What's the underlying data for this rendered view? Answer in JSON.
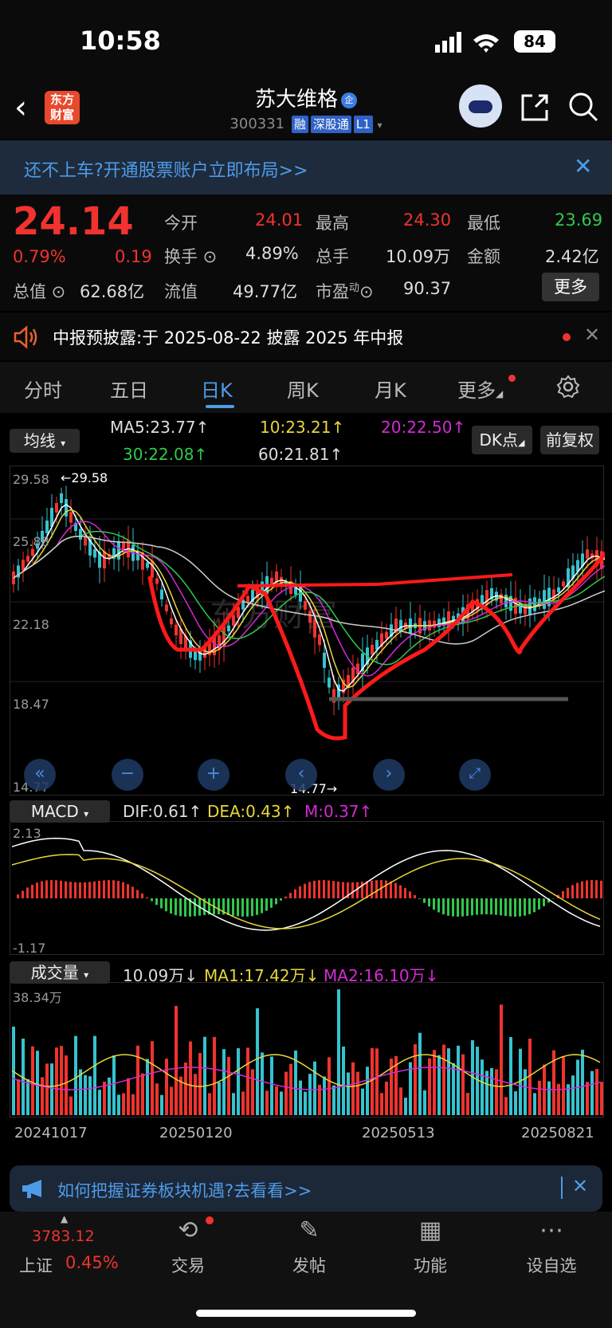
{
  "status": {
    "time": "10:58",
    "battery": "84"
  },
  "header": {
    "back_icon": "chevron-left-icon",
    "logo_line1": "东方",
    "logo_line2": "财富",
    "title": "苏大维格",
    "title_badge": "企",
    "code": "300331",
    "tags": [
      "融",
      "深股通",
      "L1"
    ]
  },
  "banner": {
    "text": "还不上车?开通股票账户立即布局>>",
    "close": "✕"
  },
  "quote": {
    "price": "24.14",
    "change_pct": "0.79%",
    "change": "0.19",
    "rows": [
      [
        {
          "label": "今开",
          "value": "24.01",
          "color": "red"
        },
        {
          "label": "最高",
          "value": "24.30",
          "color": "red"
        },
        {
          "label": "最低",
          "value": "23.69",
          "color": "green"
        }
      ],
      [
        {
          "label": "换手",
          "value": "4.89%",
          "color": "white"
        },
        {
          "label": "总手",
          "value": "10.09万",
          "color": "white"
        },
        {
          "label": "金额",
          "value": "2.42亿",
          "color": "white"
        }
      ],
      [
        {
          "label": "流值",
          "value": "49.77亿",
          "color": "white"
        },
        {
          "label": "市盈",
          "value": "90.37",
          "color": "white"
        }
      ]
    ],
    "total_value_label": "总值",
    "total_value": "62.68亿",
    "pe_sup": "动",
    "more": "更多"
  },
  "notice": {
    "text": "中报预披露:于 2025-08-22 披露 2025 年中报",
    "close": "✕"
  },
  "tabs": [
    "分时",
    "五日",
    "日K",
    "周K",
    "月K",
    "更多"
  ],
  "active_tab": "日K",
  "ma_panel": {
    "selector": "均线",
    "ma5": "MA5:23.77↑",
    "ma10": "10:23.21↑",
    "ma20": "20:22.50↑",
    "ma30": "30:22.08↑",
    "ma60": "60:21.81↑",
    "dk": "DK点",
    "fq": "前复权"
  },
  "kline": {
    "ylabels": [
      "29.58",
      "25.88",
      "22.18",
      "18.47",
      "14.77"
    ],
    "high_marker": "←29.58",
    "low_marker": "14.77→",
    "watermark": "东方财富"
  },
  "macd": {
    "selector": "MACD",
    "dif": "DIF:0.61↑",
    "dea": "DEA:0.43↑",
    "m": "M:0.37↑",
    "top": "2.13",
    "bottom": "-1.17"
  },
  "volume": {
    "selector": "成交量",
    "vol": "10.09万↓",
    "ma1": "MA1:17.42万↓",
    "ma2": "MA2:16.10万↓",
    "top": "38.34万"
  },
  "dates": [
    "20241017",
    "20250120",
    "20250513",
    "20250821"
  ],
  "ad": {
    "text": "如何把握证券板块机遇?去看看>>",
    "close": "✕"
  },
  "bottom_nav": {
    "index_value": "3783.12",
    "index_name": "上证",
    "index_pct": "0.45%",
    "items": [
      "交易",
      "发帖",
      "功能",
      "设自选"
    ]
  },
  "colors": {
    "up": "#f0332e",
    "down": "#2fc94b",
    "accent": "#4e9be8",
    "ma5": "#ffffff",
    "ma10": "#e7d63b",
    "ma20": "#d42ad4",
    "ma30": "#2fc94b",
    "ma60": "#cccccc"
  }
}
